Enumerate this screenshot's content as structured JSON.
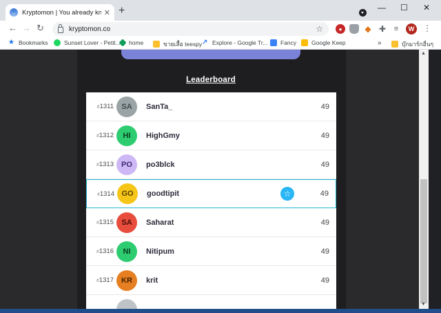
{
  "browser": {
    "tab_title": "Kryptomon | You already know w",
    "new_tab": "+",
    "url": "kryptomon.co",
    "window_controls": {
      "minimize": "—",
      "maximize": "☐",
      "close": "✕"
    },
    "profile_initial": "W"
  },
  "bookmarks": [
    {
      "label": "Bookmarks",
      "color": "#1a73e8"
    },
    {
      "label": "Sunset Lover - Petit...",
      "color": "#1ed760"
    },
    {
      "label": "home",
      "color": "#0f9d58"
    },
    {
      "label": "ขายเสื้อ teespy",
      "color": "#fbc02d"
    },
    {
      "label": "Explore - Google Tr...",
      "color": "#4285f4"
    },
    {
      "label": "Fancy",
      "color": "#3b82f6"
    },
    {
      "label": "Google Keep",
      "color": "#fbbc04"
    },
    {
      "label": "»",
      "color": ""
    },
    {
      "label": "บุ๊กมาร์กอื่นๆ",
      "color": "#fbc02d"
    }
  ],
  "page": {
    "leaderboard_title": "Leaderboard",
    "rows": [
      {
        "rank": "1311",
        "initials": "SA",
        "name": "SanTa_",
        "score": "49",
        "color": "#9aa4a6",
        "text_color": "#3d4a4c"
      },
      {
        "rank": "1312",
        "initials": "HI",
        "name": "HighGmy",
        "score": "49",
        "color": "#2ecc71",
        "text_color": "#0b3d20"
      },
      {
        "rank": "1313",
        "initials": "PO",
        "name": "po3blck",
        "score": "49",
        "color": "#cdb7f5",
        "text_color": "#3e2a72"
      },
      {
        "rank": "1314",
        "initials": "GO",
        "name": "goodtipit",
        "score": "49",
        "color": "#f5c518",
        "text_color": "#5a4300",
        "highlight": true
      },
      {
        "rank": "1315",
        "initials": "SA",
        "name": "Saharat",
        "score": "49",
        "color": "#e74c3c",
        "text_color": "#4a0f08"
      },
      {
        "rank": "1316",
        "initials": "NI",
        "name": "Nitipum",
        "score": "49",
        "color": "#2ecc71",
        "text_color": "#0b3d20"
      },
      {
        "rank": "1317",
        "initials": "KR",
        "name": "krit",
        "score": "49",
        "color": "#e67e22",
        "text_color": "#4a2300"
      },
      {
        "rank": "",
        "initials": "",
        "name": "",
        "score": "",
        "color": "#bdc3c7",
        "text_color": "#333"
      }
    ]
  }
}
